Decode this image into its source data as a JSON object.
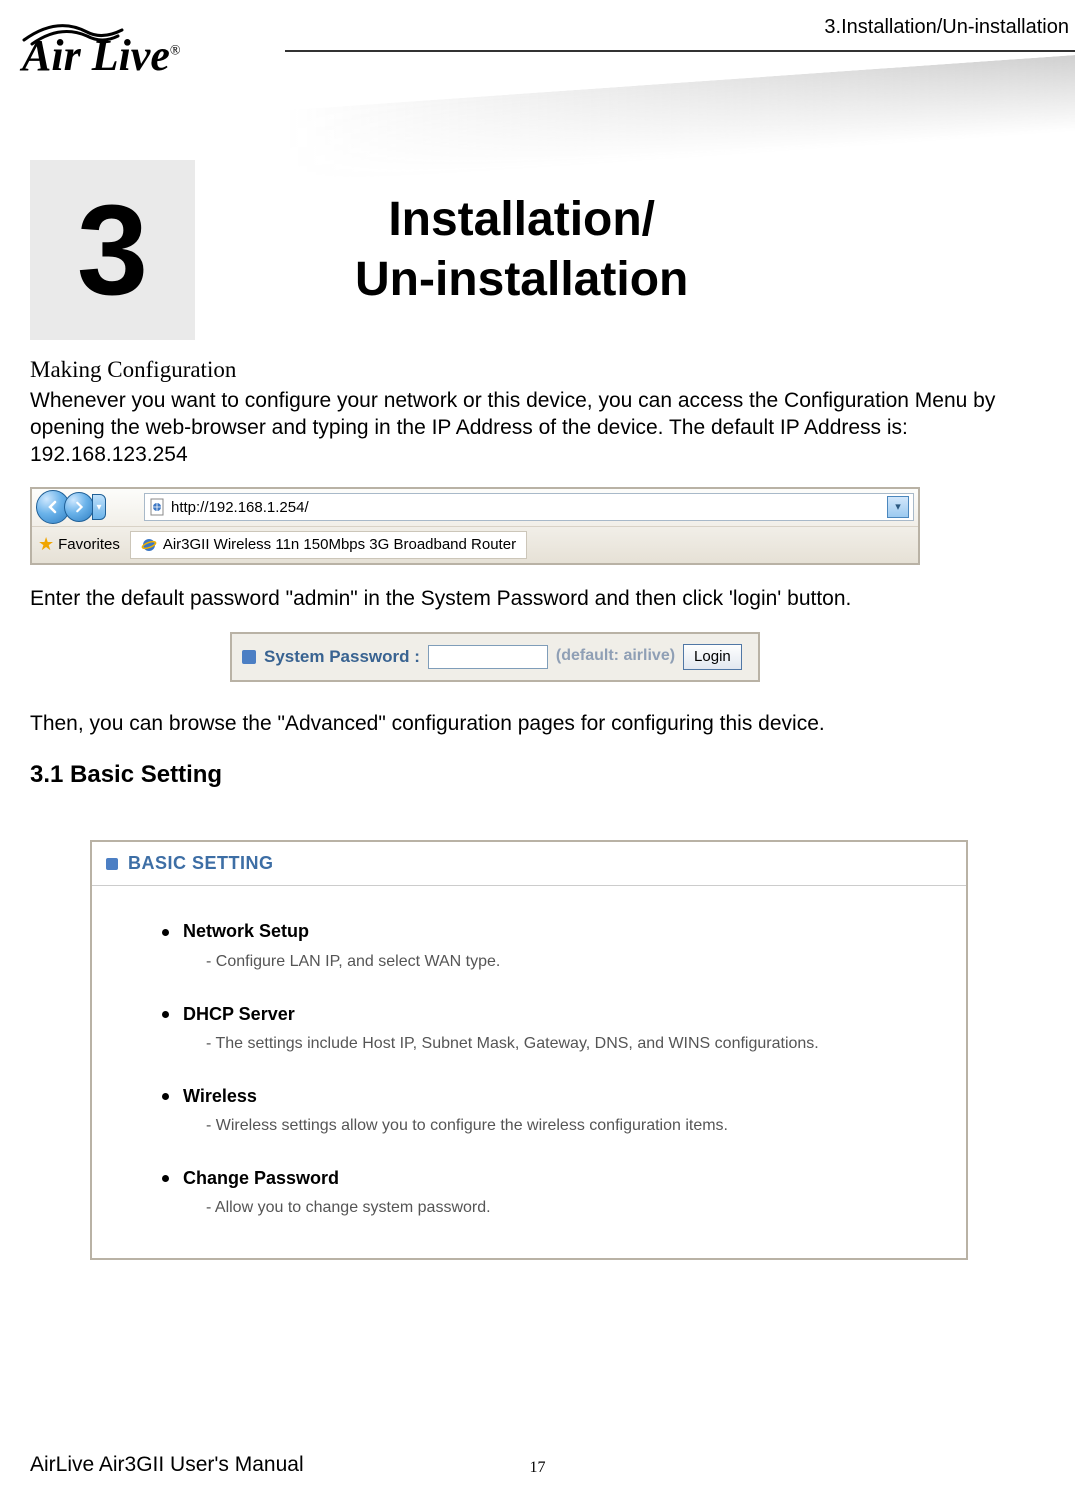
{
  "header": {
    "breadcrumb": "3.Installation/Un-installation",
    "logo_text": "Air Live",
    "logo_reg": "®"
  },
  "chapter": {
    "number": "3",
    "title_line1": "Installation/",
    "title_line2": "Un-installation"
  },
  "section": {
    "making": "Making Configuration",
    "intro": "Whenever you want to configure your network or this device, you can access the Configuration Menu by opening the web-browser and typing in the IP Address of the device. The default IP Address is: 192.168.123.254",
    "password_para": "Enter the default password \"admin\" in the System Password and then click 'login' button.",
    "advanced_para": "Then, you can browse the \"Advanced\" configuration pages for configuring this device.",
    "basic_heading": "3.1 Basic Setting"
  },
  "browser": {
    "url": "http://192.168.1.254/",
    "favorites_label": "Favorites",
    "tab_title": "Air3GII Wireless 11n 150Mbps 3G Broadband Router"
  },
  "login": {
    "label": "System Password :",
    "default_hint": "(default: airlive)",
    "button": "Login"
  },
  "panel": {
    "title": "BASIC SETTING",
    "items": [
      {
        "title": "Network Setup",
        "desc": "- Configure LAN IP, and select WAN type."
      },
      {
        "title": "DHCP Server",
        "desc": "- The settings include Host IP, Subnet Mask, Gateway, DNS, and WINS configurations."
      },
      {
        "title": "Wireless",
        "desc": "- Wireless settings allow you to configure the wireless configuration items."
      },
      {
        "title": "Change Password",
        "desc": "- Allow you to change system password."
      }
    ]
  },
  "footer": {
    "manual": "AirLive Air3GII User's Manual",
    "page": "17"
  }
}
